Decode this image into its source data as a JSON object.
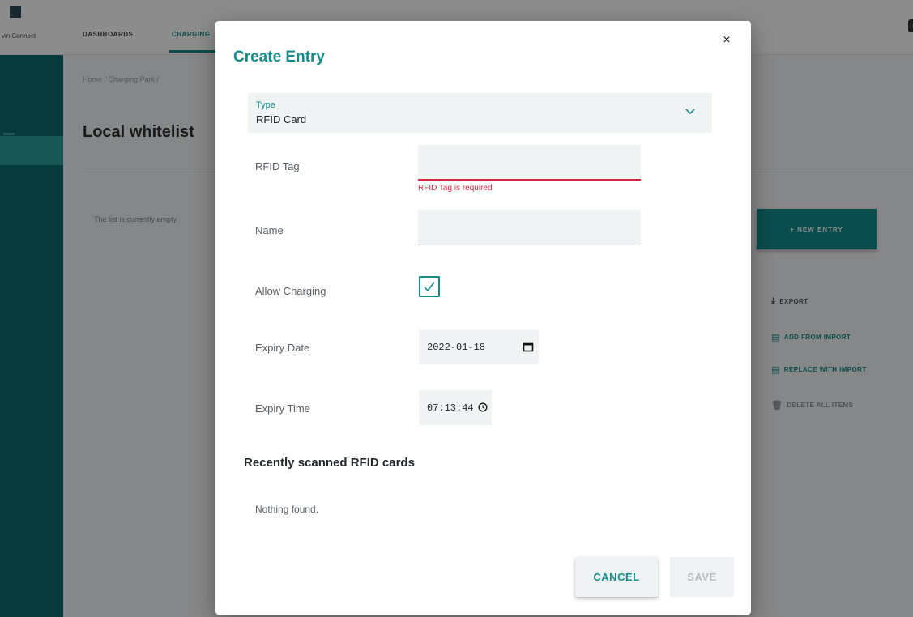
{
  "background": {
    "nav": {
      "logo_text": "vin Connect",
      "items": [
        {
          "label": "DASHBOARDS",
          "active": false
        },
        {
          "label": "CHARGING",
          "active": true
        }
      ]
    },
    "breadcrumb": "Home  /  Charging Park  /",
    "page_title": "Local whitelist",
    "empty_text": "The list is currently empty",
    "new_entry_button": "+ NEW ENTRY",
    "side_actions": {
      "export": "EXPORT",
      "add_from_import": "ADD FROM IMPORT",
      "replace_with_import": "REPLACE WITH IMPORT",
      "delete_all_items": "DELETE ALL ITEMS"
    }
  },
  "dialog": {
    "title": "Create Entry",
    "close_glyph": "×",
    "type_select": {
      "label": "Type",
      "value": "RFID Card"
    },
    "fields": {
      "rfid_tag": {
        "label": "RFID Tag",
        "value": "",
        "error": "RFID Tag is required"
      },
      "name": {
        "label": "Name",
        "value": ""
      },
      "allow_charging": {
        "label": "Allow Charging",
        "checked": true
      },
      "expiry_date": {
        "label": "Expiry Date",
        "value": "2022-01-18"
      },
      "expiry_time": {
        "label": "Expiry Time",
        "value": "07:13:44"
      }
    },
    "recent_section": {
      "title": "Recently scanned RFID cards",
      "empty_text": "Nothing found."
    },
    "buttons": {
      "cancel": "CANCEL",
      "save": "SAVE"
    }
  },
  "colors": {
    "accent": "#148c8c",
    "error": "#d7263d",
    "sidebar": "#0e6a6d",
    "field_background": "#f0f3f4"
  },
  "icons": {
    "close": "close-icon",
    "type_dropdown": "chevron-down-icon",
    "checkbox": "check-icon",
    "date_picker": "calendar-icon",
    "time_picker": "clock-icon"
  }
}
